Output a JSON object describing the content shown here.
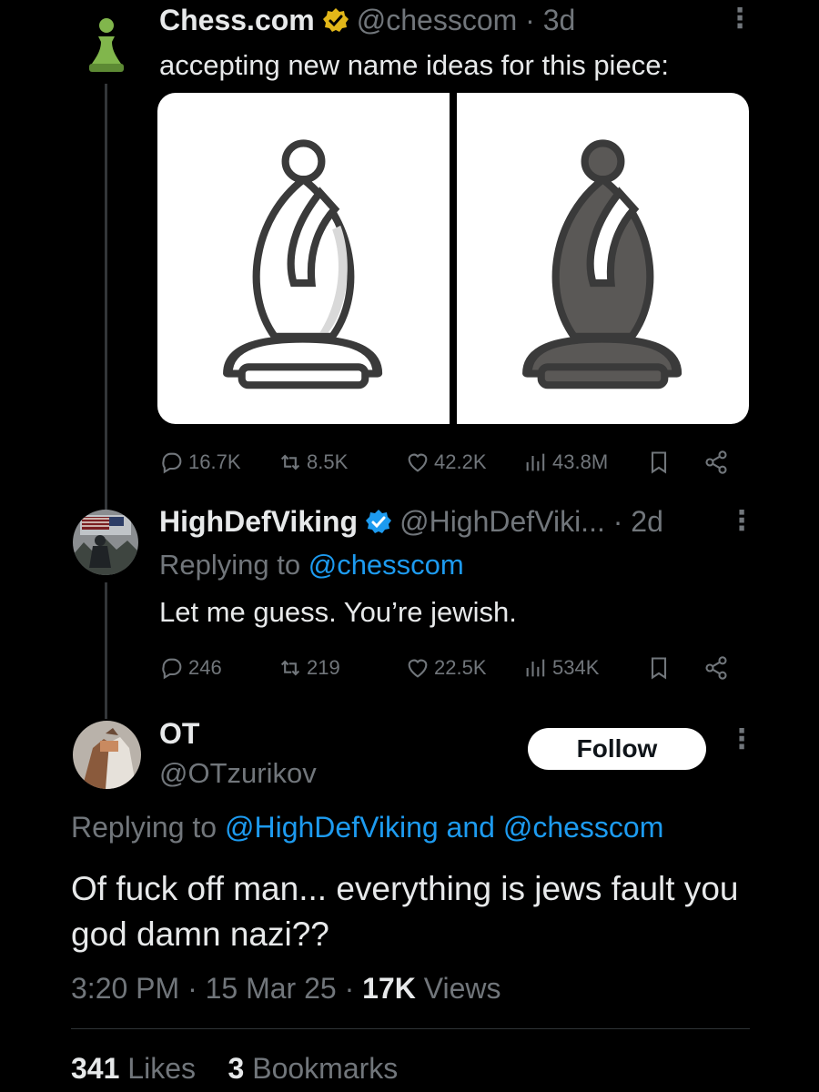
{
  "tweet1": {
    "display_name": "Chess.com",
    "handle": "@chesscom",
    "time": "3d",
    "text": "accepting new name ideas for this piece:",
    "stats": {
      "replies": "16.7K",
      "reposts": "8.5K",
      "likes": "42.2K",
      "views": "43.8M"
    }
  },
  "tweet2": {
    "display_name": "HighDefViking",
    "handle": "@HighDefViki...",
    "time": "2d",
    "replying_prefix": "Replying to",
    "replying_to": "@chesscom",
    "text": "Let me guess. You’re jewish.",
    "stats": {
      "replies": "246",
      "reposts": "219",
      "likes": "22.5K",
      "views": "534K"
    }
  },
  "tweet3": {
    "display_name": "OT",
    "handle": "@OTzurikov",
    "follow_label": "Follow",
    "replying_prefix": "Replying to",
    "replying_to_1": "@HighDefViking",
    "replying_and": "and",
    "replying_to_2": "@chesscom",
    "text": "Of fuck off man... everything is jews fault you god damn nazi??",
    "time": "3:20 PM",
    "date": "15 Mar 25",
    "views_count": "17K",
    "views_label": "Views",
    "likes_count": "341",
    "likes_label": "Likes",
    "bookmarks_count": "3",
    "bookmarks_label": "Bookmarks"
  },
  "colors": {
    "background": "#000000",
    "text": "#e7e9ea",
    "muted": "#71767b",
    "accent": "#1d9bf0",
    "gold": "#e2b719"
  }
}
